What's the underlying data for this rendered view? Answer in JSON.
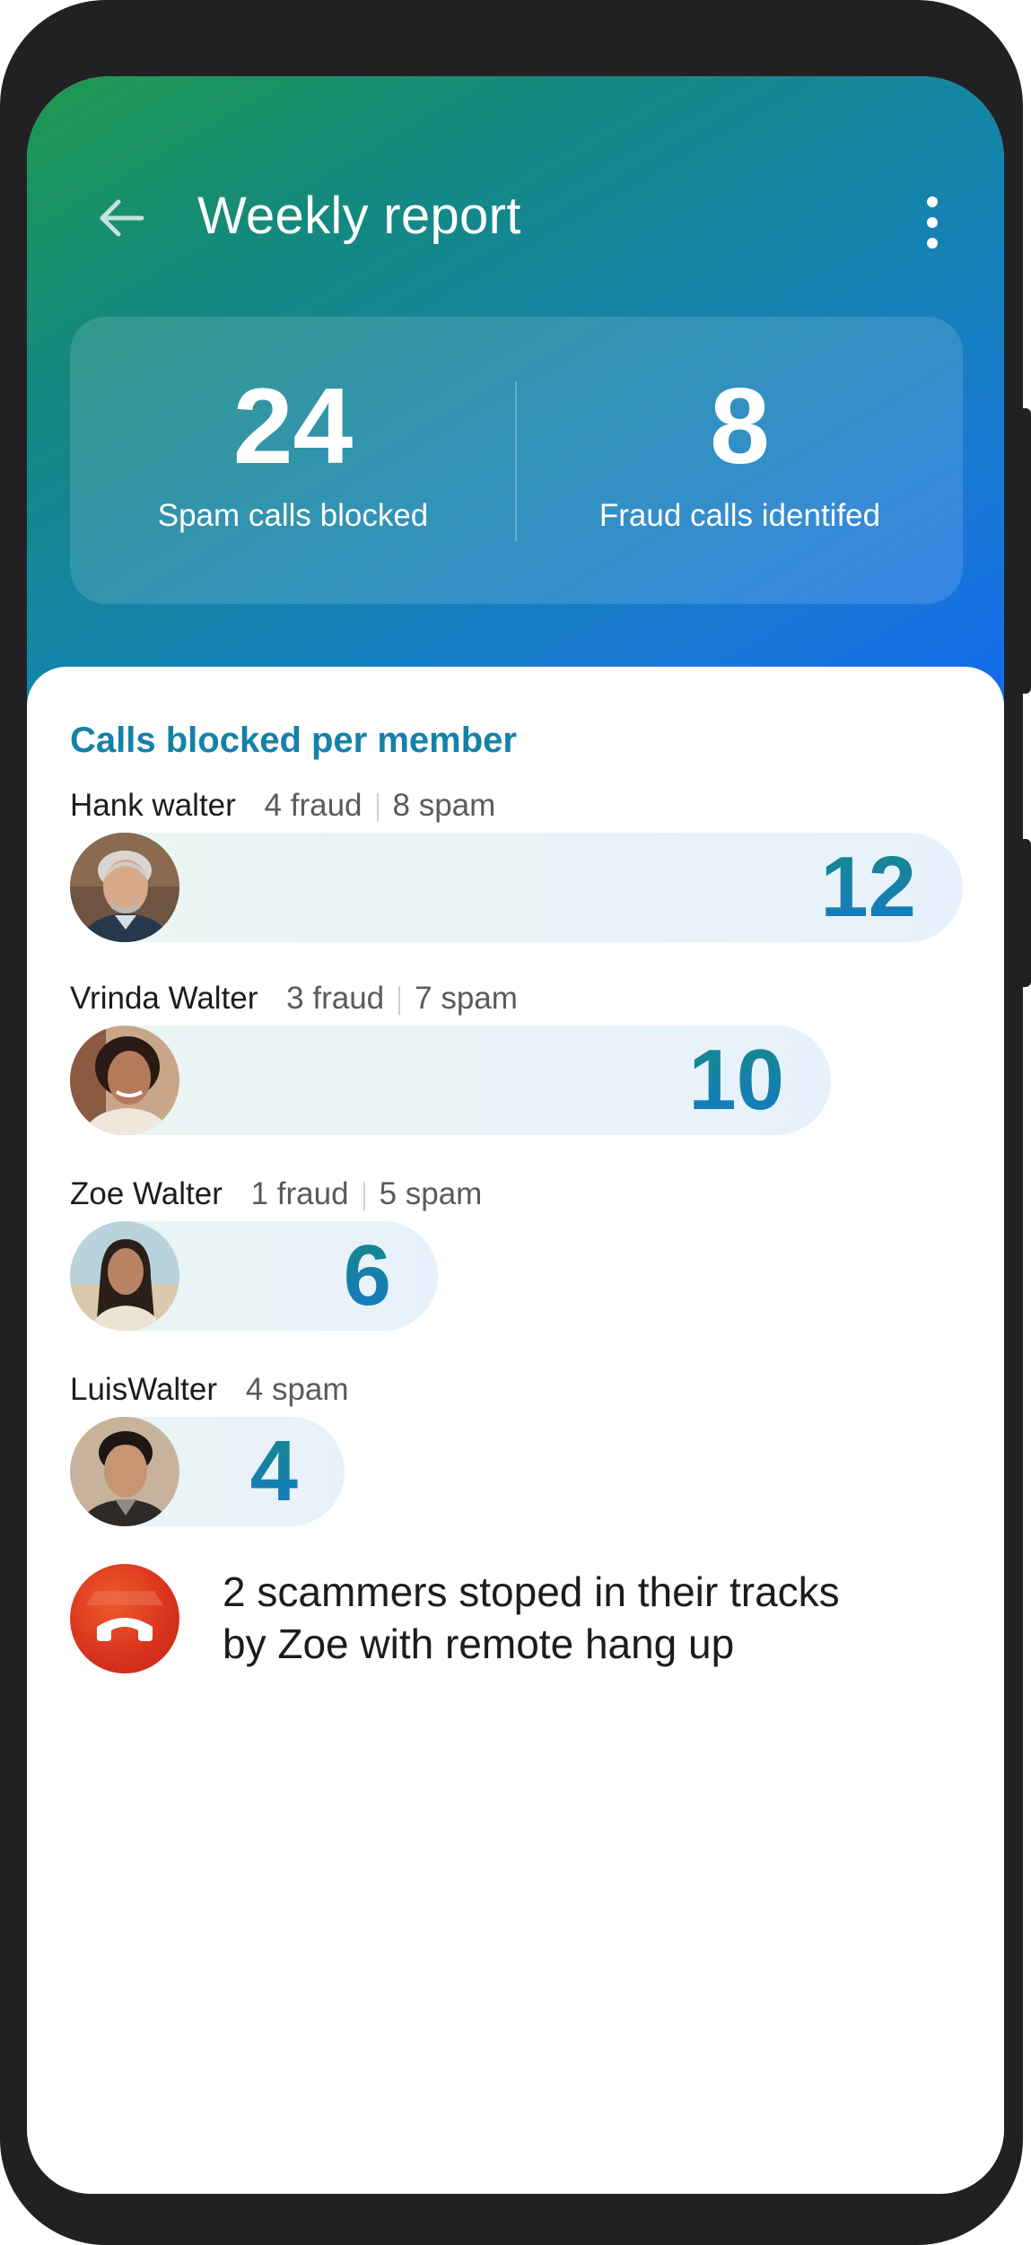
{
  "header": {
    "title": "Weekly report",
    "back_icon": "arrow-left-icon",
    "menu_icon": "more-vertical-icon",
    "gradient": [
      "#1e9a4e",
      "#1483b0",
      "#1268ec"
    ]
  },
  "stats": {
    "spam": {
      "value": "24",
      "label": "Spam calls blocked"
    },
    "fraud": {
      "value": "8",
      "label": "Fraud calls identifed"
    }
  },
  "section": {
    "title": "Calls blocked per member",
    "color": "#1481a9"
  },
  "members": [
    {
      "name": "Hank walter",
      "fraud": "4 fraud",
      "spam": "8 spam",
      "total": "12",
      "bar_fraction": 1.0
    },
    {
      "name": "Vrinda Walter",
      "fraud": "3 fraud",
      "spam": "7 spam",
      "total": "10",
      "bar_fraction": 0.85
    },
    {
      "name": "Zoe Walter",
      "fraud": "1 fraud",
      "spam": "5 spam",
      "total": "6",
      "bar_fraction": 0.41
    },
    {
      "name": "LuisWalter",
      "spam": "4 spam",
      "total": "4"
    }
  ],
  "hangup_note": {
    "icon": "hang-up-icon",
    "line1": "2 scammers stoped in their tracks",
    "line2": "by Zoe with remote hang up",
    "color": "#d8321c"
  }
}
